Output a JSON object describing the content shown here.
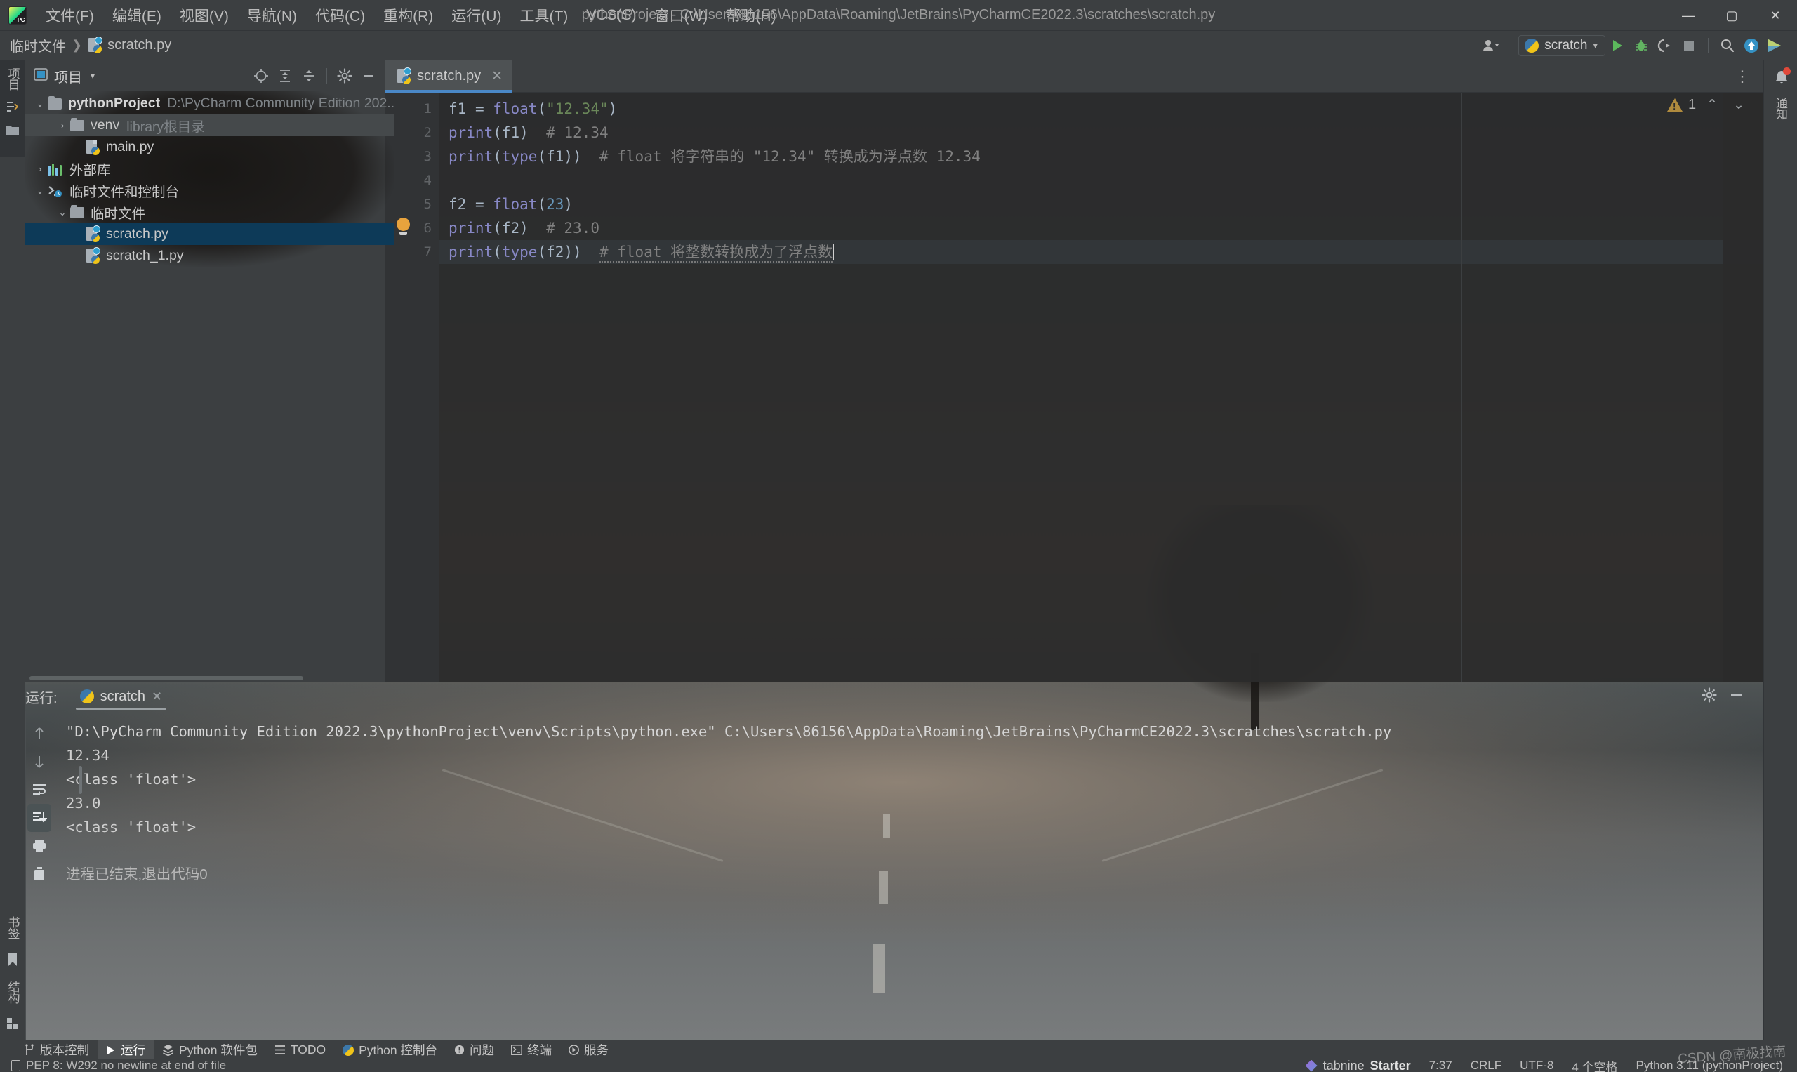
{
  "window": {
    "title": "pythonProject - C:\\Users\\86156\\AppData\\Roaming\\JetBrains\\PyCharmCE2022.3\\scratches\\scratch.py",
    "minimize": "—",
    "maximize": "▢",
    "close": "✕"
  },
  "menu": {
    "items": [
      {
        "label": "文件(F)"
      },
      {
        "label": "编辑(E)"
      },
      {
        "label": "视图(V)"
      },
      {
        "label": "导航(N)"
      },
      {
        "label": "代码(C)"
      },
      {
        "label": "重构(R)"
      },
      {
        "label": "运行(U)"
      },
      {
        "label": "工具(T)"
      },
      {
        "label": "VCS(S)"
      },
      {
        "label": "窗口(W)"
      },
      {
        "label": "帮助(H)"
      }
    ]
  },
  "navbar": {
    "breadcrumb": [
      {
        "label": "临时文件"
      },
      {
        "label": "scratch.py"
      }
    ],
    "separator": "❯",
    "run_config_name": "scratch",
    "dropdown_caret": "▾"
  },
  "project_panel": {
    "title": "项目",
    "caret": "▾",
    "tools": [
      "locate-icon",
      "expand-all-icon",
      "collapse-all-icon",
      "settings-icon",
      "hide-icon"
    ],
    "tree": [
      {
        "label": "pythonProject",
        "secondary": "D:\\PyCharm Community Edition 202..",
        "chev": "⌄",
        "indent": 0,
        "kind": "folder",
        "bold": true,
        "state": "normal"
      },
      {
        "label": "venv",
        "secondary": "library根目录",
        "chev": "›",
        "indent": 1,
        "kind": "folder",
        "bold": false,
        "state": "hover"
      },
      {
        "label": "main.py",
        "secondary": "",
        "chev": "",
        "indent": 2,
        "kind": "pyfile",
        "bold": false,
        "state": "normal"
      },
      {
        "label": "外部库",
        "secondary": "",
        "chev": "›",
        "indent": 0,
        "kind": "library",
        "bold": false,
        "state": "normal"
      },
      {
        "label": "临时文件和控制台",
        "secondary": "",
        "chev": "⌄",
        "indent": 0,
        "kind": "scratchroot",
        "bold": false,
        "state": "normal"
      },
      {
        "label": "临时文件",
        "secondary": "",
        "chev": "⌄",
        "indent": 1,
        "kind": "folder",
        "bold": false,
        "state": "normal"
      },
      {
        "label": "scratch.py",
        "secondary": "",
        "chev": "",
        "indent": 2,
        "kind": "pyfile",
        "bold": false,
        "state": "selected"
      },
      {
        "label": "scratch_1.py",
        "secondary": "",
        "chev": "",
        "indent": 2,
        "kind": "pyfile",
        "bold": false,
        "state": "normal"
      }
    ]
  },
  "left_strip": {
    "labels": [
      "项目"
    ],
    "icons": [
      "structure-icon",
      "folder-icon"
    ],
    "bottom_labels": [
      "书签",
      "结构"
    ]
  },
  "editor": {
    "tab": {
      "label": "scratch.py",
      "close": "✕"
    },
    "more": "⋮",
    "warnings": {
      "count": "1",
      "up": "⌃",
      "down": "⌄"
    },
    "gutter": [
      "1",
      "2",
      "3",
      "4",
      "5",
      "6",
      "7"
    ],
    "lines": [
      {
        "n": 1,
        "tokens": [
          {
            "t": "f1 ",
            "c": "var"
          },
          {
            "t": "= ",
            "c": "def"
          },
          {
            "t": "float",
            "c": "fn"
          },
          {
            "t": "(",
            "c": "def"
          },
          {
            "t": "\"12.34\"",
            "c": "str"
          },
          {
            "t": ")",
            "c": "def"
          }
        ]
      },
      {
        "n": 2,
        "tokens": [
          {
            "t": "print",
            "c": "fn"
          },
          {
            "t": "(",
            "c": "def"
          },
          {
            "t": "f1",
            "c": "var"
          },
          {
            "t": ")  ",
            "c": "def"
          },
          {
            "t": "# 12.34",
            "c": "com"
          }
        ]
      },
      {
        "n": 3,
        "tokens": [
          {
            "t": "print",
            "c": "fn"
          },
          {
            "t": "(",
            "c": "def"
          },
          {
            "t": "type",
            "c": "fn"
          },
          {
            "t": "(",
            "c": "def"
          },
          {
            "t": "f1",
            "c": "var"
          },
          {
            "t": "))  ",
            "c": "def"
          },
          {
            "t": "# float 将字符串的 \"12.34\" 转换成为浮点数 12.34",
            "c": "com"
          }
        ]
      },
      {
        "n": 4,
        "tokens": []
      },
      {
        "n": 5,
        "tokens": [
          {
            "t": "f2 ",
            "c": "var"
          },
          {
            "t": "= ",
            "c": "def"
          },
          {
            "t": "float",
            "c": "fn"
          },
          {
            "t": "(",
            "c": "def"
          },
          {
            "t": "23",
            "c": "num"
          },
          {
            "t": ")",
            "c": "def"
          }
        ]
      },
      {
        "n": 6,
        "tokens": [
          {
            "t": "print",
            "c": "fn"
          },
          {
            "t": "(",
            "c": "def"
          },
          {
            "t": "f2",
            "c": "var"
          },
          {
            "t": ")  ",
            "c": "def"
          },
          {
            "t": "# 23.0",
            "c": "com"
          }
        ]
      },
      {
        "n": 7,
        "tokens": [
          {
            "t": "print",
            "c": "fn"
          },
          {
            "t": "(",
            "c": "def"
          },
          {
            "t": "type",
            "c": "fn"
          },
          {
            "t": "(",
            "c": "def"
          },
          {
            "t": "f2",
            "c": "var"
          },
          {
            "t": "))  ",
            "c": "def"
          },
          {
            "t": "# float 将整数转换成为了浮点数",
            "c": "com-squiggle"
          }
        ]
      }
    ],
    "current_line": 7
  },
  "run_panel": {
    "label": "运行:",
    "tab_name": "scratch",
    "tab_close": "✕",
    "toolbar_left": [
      "rerun-icon",
      "wrench-icon",
      "stop-icon",
      "layout-icon",
      "pin-icon"
    ],
    "toolbar_right": [
      "arrow-up-icon",
      "arrow-down-icon",
      "soft-wrap-icon",
      "scroll-to-end-icon",
      "print-icon",
      "trash-icon"
    ],
    "header_right": [
      "settings-icon",
      "hide-icon"
    ],
    "console": [
      {
        "text": "\"D:\\PyCharm Community Edition 2022.3\\pythonProject\\venv\\Scripts\\python.exe\" C:\\Users\\86156\\AppData\\Roaming\\JetBrains\\PyCharmCE2022.3\\scratches\\scratch.py",
        "kind": "cmd"
      },
      {
        "text": "12.34",
        "kind": "out"
      },
      {
        "text": "<class 'float'>",
        "kind": "out"
      },
      {
        "text": "23.0",
        "kind": "out"
      },
      {
        "text": "<class 'float'>",
        "kind": "out"
      },
      {
        "text": "",
        "kind": "out"
      },
      {
        "text": "进程已结束,退出代码0",
        "kind": "exit"
      }
    ]
  },
  "toolwindow_bar": {
    "items": [
      {
        "label": "版本控制",
        "icon": "branch-icon",
        "active": false
      },
      {
        "label": "运行",
        "icon": "play-icon",
        "active": true
      },
      {
        "label": "Python 软件包",
        "icon": "packages-icon",
        "active": false
      },
      {
        "label": "TODO",
        "icon": "list-icon",
        "active": false
      },
      {
        "label": "Python 控制台",
        "icon": "python-icon",
        "active": false
      },
      {
        "label": "问题",
        "icon": "problems-icon",
        "active": false
      },
      {
        "label": "终端",
        "icon": "terminal-icon",
        "active": false
      },
      {
        "label": "服务",
        "icon": "services-icon",
        "active": false
      }
    ]
  },
  "statusbar": {
    "message": "PEP 8: W292 no newline at end of file",
    "tabnine": "tabnine",
    "tabnine_plan": "Starter",
    "caret_position": "7:37",
    "line_separator": "CRLF",
    "encoding": "UTF-8",
    "indent": "4 个空格",
    "interpreter": "Python 3.11 (pythonProject)"
  },
  "watermark": "CSDN @南极找南",
  "colors": {
    "accent": "#4a88c7",
    "selection": "#0d3a58",
    "chrome": "#3c3f41",
    "editor_bg": "#2b2b2b",
    "string": "#6a8759",
    "number": "#6897bb",
    "function": "#8888c6",
    "comment": "#808080",
    "warning": "#b08b3e",
    "run_green": "#5cb85c"
  }
}
